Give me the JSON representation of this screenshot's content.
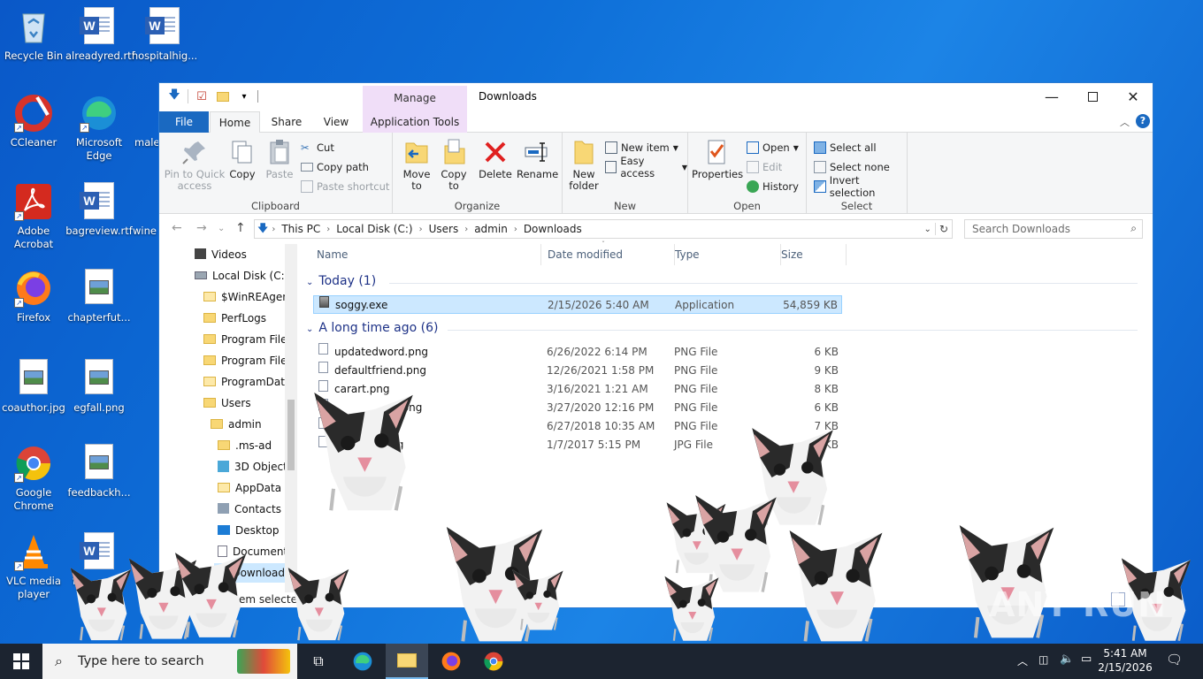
{
  "desktop": {
    "icons": [
      {
        "label": "Recycle Bin"
      },
      {
        "label": "alreadyred.rtf"
      },
      {
        "label": "hospitalhig..."
      },
      {
        "label": "CCleaner"
      },
      {
        "label": "Microsoft Edge"
      },
      {
        "label": "male"
      },
      {
        "label": "Adobe Acrobat"
      },
      {
        "label": "bagreview.rtf"
      },
      {
        "label": "wine"
      },
      {
        "label": "Firefox"
      },
      {
        "label": "chapterfut..."
      },
      {
        "label": "coauthor.jpg"
      },
      {
        "label": "egfall.png"
      },
      {
        "label": "Google Chrome"
      },
      {
        "label": "feedbackh..."
      },
      {
        "label": "VLC media player"
      },
      {
        "label": "f"
      }
    ]
  },
  "window": {
    "title": "Downloads",
    "manage_label": "Manage",
    "tabs": {
      "file": "File",
      "home": "Home",
      "share": "Share",
      "view": "View",
      "app_tools": "Application Tools"
    },
    "ribbon": {
      "clipboard": {
        "label": "Clipboard",
        "pin": "Pin to Quick access",
        "copy": "Copy",
        "paste": "Paste",
        "cut": "Cut",
        "copy_path": "Copy path",
        "paste_shortcut": "Paste shortcut"
      },
      "organize": {
        "label": "Organize",
        "move_to": "Move to",
        "copy_to": "Copy to",
        "delete": "Delete",
        "rename": "Rename"
      },
      "new": {
        "label": "New",
        "new_folder": "New folder",
        "new_item": "New item",
        "easy_access": "Easy access"
      },
      "open": {
        "label": "Open",
        "properties": "Properties",
        "open": "Open",
        "edit": "Edit",
        "history": "History"
      },
      "select": {
        "label": "Select",
        "select_all": "Select all",
        "select_none": "Select none",
        "invert": "Invert selection"
      }
    },
    "address": {
      "crumbs": [
        "This PC",
        "Local Disk (C:)",
        "Users",
        "admin",
        "Downloads"
      ]
    },
    "search_placeholder": "Search Downloads",
    "nav": [
      {
        "label": "Videos"
      },
      {
        "label": "Local Disk (C:)"
      },
      {
        "label": "$WinREAgent"
      },
      {
        "label": "PerfLogs"
      },
      {
        "label": "Program Files"
      },
      {
        "label": "Program Files"
      },
      {
        "label": "ProgramData"
      },
      {
        "label": "Users"
      },
      {
        "label": "admin"
      },
      {
        "label": ".ms-ad"
      },
      {
        "label": "3D Objects"
      },
      {
        "label": "AppData"
      },
      {
        "label": "Contacts"
      },
      {
        "label": "Desktop"
      },
      {
        "label": "Documents"
      },
      {
        "label": "Downloads"
      }
    ],
    "columns": {
      "name": "Name",
      "date": "Date modified",
      "type": "Type",
      "size": "Size"
    },
    "groups": {
      "today": "Today (1)",
      "older": "A long time ago (6)"
    },
    "today_files": [
      {
        "name": "soggy.exe",
        "date": "2/15/2026 5:40 AM",
        "type": "Application",
        "size": "54,859 KB"
      }
    ],
    "older_files": [
      {
        "name": "updatedword.png",
        "date": "6/26/2022 6:14 PM",
        "type": "PNG File",
        "size": "6 KB"
      },
      {
        "name": "defaultfriend.png",
        "date": "12/26/2021 1:58 PM",
        "type": "PNG File",
        "size": "9 KB"
      },
      {
        "name": "carart.png",
        "date": "3/16/2021 1:21 AM",
        "type": "PNG File",
        "size": "8 KB"
      },
      {
        "name": "t.png",
        "date": "3/27/2020 12:16 PM",
        "type": "PNG File",
        "size": "6 KB"
      },
      {
        "name": "g",
        "date": "6/27/2018 10:35 AM",
        "type": "PNG File",
        "size": "7 KB"
      },
      {
        "name": ".jpg",
        "date": "1/7/2017 5:15 PM",
        "type": "JPG File",
        "size": "2 KB"
      }
    ],
    "status": "item selected"
  },
  "taskbar": {
    "search_placeholder": "Type here to search",
    "time": "5:41 AM",
    "date": "2/15/2026"
  },
  "watermark": "ANY RUN"
}
